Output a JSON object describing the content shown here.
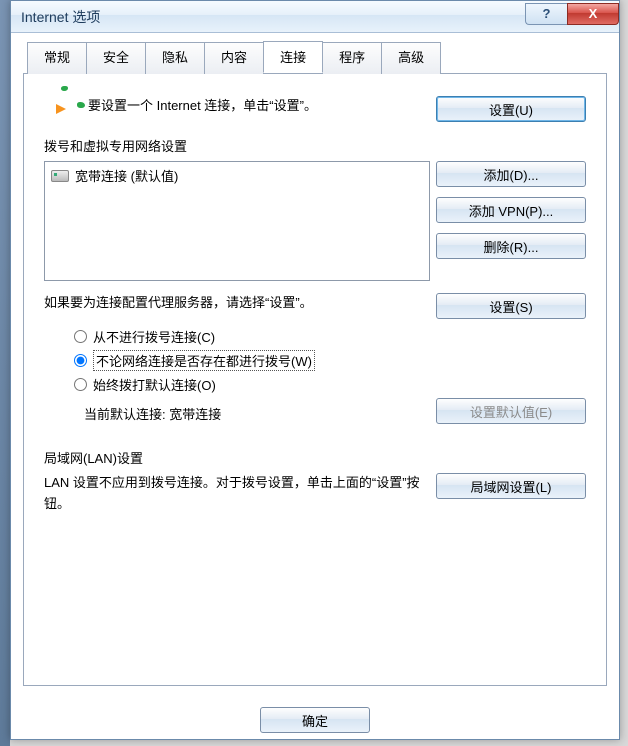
{
  "window": {
    "title": "Internet 选项"
  },
  "titlebar_buttons": {
    "help": "?",
    "close": "X"
  },
  "tabs": {
    "general": "常规",
    "security": "安全",
    "privacy": "隐私",
    "content": "内容",
    "connections": "连接",
    "programs": "程序",
    "advanced": "高级"
  },
  "setup": {
    "text": "要设置一个 Internet 连接，单击“设置”。",
    "button": "设置(U)"
  },
  "dialup": {
    "section_label": "拨号和虚拟专用网络设置",
    "list_item": "宽带连接 (默认值)",
    "add": "添加(D)...",
    "add_vpn": "添加 VPN(P)...",
    "remove": "删除(R)...",
    "proxy_text": "如果要为连接配置代理服务器，请选择“设置”。",
    "settings": "设置(S)",
    "radio_never": "从不进行拨号连接(C)",
    "radio_whenever": "不论网络连接是否存在都进行拨号(W)",
    "radio_always": "始终拨打默认连接(O)",
    "current_default": "当前默认连接: 宽带连接",
    "set_default": "设置默认值(E)"
  },
  "lan": {
    "section_label": "局域网(LAN)设置",
    "text": "LAN 设置不应用到拨号连接。对于拨号设置，单击上面的“设置”按钮。",
    "button": "局域网设置(L)"
  },
  "footer": {
    "ok": "确定"
  }
}
